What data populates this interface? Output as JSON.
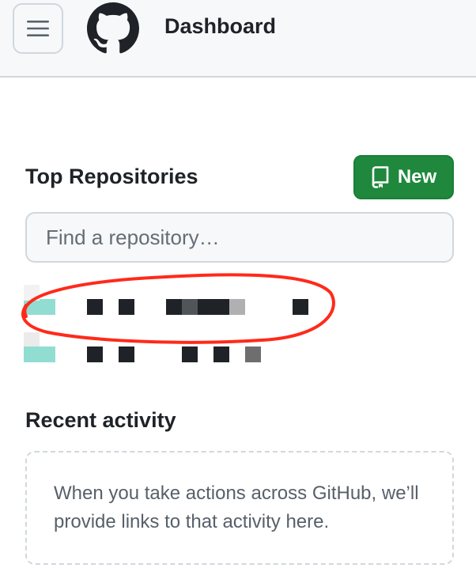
{
  "header": {
    "title": "Dashboard",
    "menu_icon": "hamburger-icon",
    "logo_icon": "github-logo-icon"
  },
  "top_repositories": {
    "title": "Top Repositories",
    "new_button_label": "New",
    "new_button_icon": "repo-icon",
    "search_placeholder": "Find a repository…",
    "rows_note": "repository names are redacted (pixelated) in the screenshot"
  },
  "recent_activity": {
    "title": "Recent activity",
    "empty_message": "When you take actions across GitHub, we’ll provide links to that activity here."
  },
  "colors": {
    "header_bg": "#f6f8fa",
    "border": "#d0d7de",
    "primary_button": "#1f883d",
    "annotation_stroke": "#ff2a1a"
  }
}
